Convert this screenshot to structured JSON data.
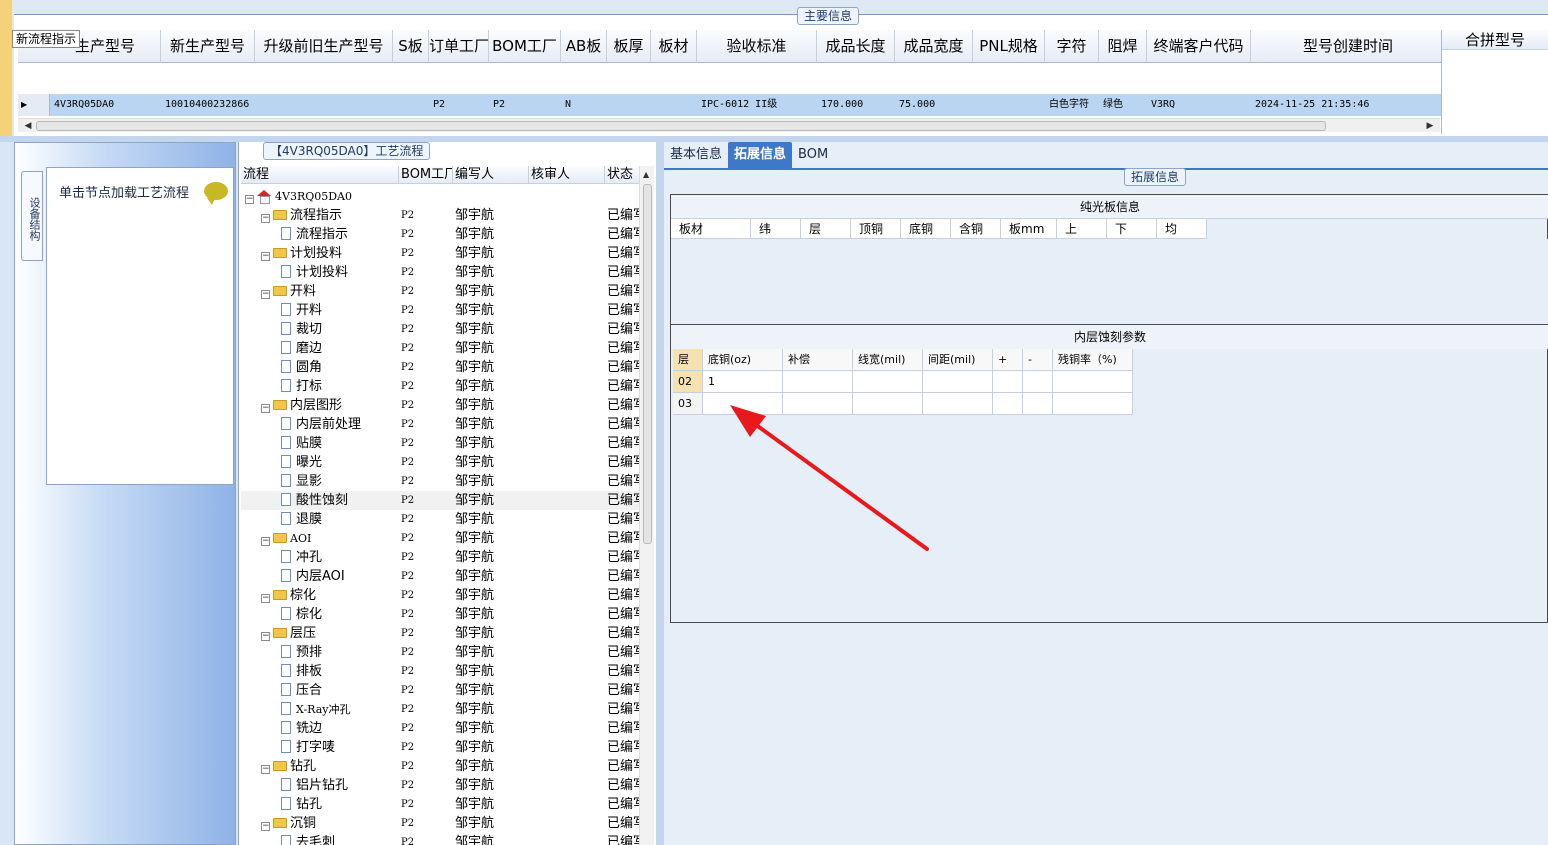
{
  "tooltip": {
    "text": "新流程指示"
  },
  "main_info": {
    "legend": "主要信息",
    "columns": [
      "生产型号",
      "新生产型号",
      "升级前旧生产型号",
      "S板",
      "订单工厂",
      "BOM工厂",
      "AB板",
      "板厚",
      "板材",
      "验收标准",
      "成品长度",
      "成品宽度",
      "PNL规格",
      "字符",
      "阻焊",
      "终端客户代码",
      "型号创建时间"
    ],
    "row": [
      "4V3RQ05DA0",
      "10010400232866",
      "",
      "",
      "P2",
      "P2",
      "N",
      "",
      "",
      "IPC-6012 II级",
      "170.000",
      "75.000",
      "",
      "白色字符",
      "绿色",
      "V3RQ",
      "2024-11-25 21:35:46"
    ],
    "merge_header": "合拼型号"
  },
  "left_panel": {
    "vertical_tab": "设备结构",
    "item": "单击节点加载工艺流程"
  },
  "tree": {
    "legend": "【4V3RQ05DA0】工艺流程",
    "columns": [
      "流程",
      "BOM工厂",
      "编写人",
      "核审人",
      "状态"
    ],
    "rows": [
      {
        "level": 0,
        "type": "root",
        "label": "4V3RQ05DA0",
        "bom": "",
        "writer": "",
        "status": ""
      },
      {
        "level": 1,
        "type": "folder",
        "label": "流程指示",
        "bom": "P2",
        "writer": "邹宇航",
        "status": "已编写"
      },
      {
        "level": 2,
        "type": "doc",
        "label": "流程指示",
        "bom": "P2",
        "writer": "邹宇航",
        "status": "已编写"
      },
      {
        "level": 1,
        "type": "folder",
        "label": "计划投料",
        "bom": "P2",
        "writer": "邹宇航",
        "status": "已编写"
      },
      {
        "level": 2,
        "type": "doc",
        "label": "计划投料",
        "bom": "P2",
        "writer": "邹宇航",
        "status": "已编写"
      },
      {
        "level": 1,
        "type": "folder",
        "label": "开料",
        "bom": "P2",
        "writer": "邹宇航",
        "status": "已编写"
      },
      {
        "level": 2,
        "type": "doc",
        "label": "开料",
        "bom": "P2",
        "writer": "邹宇航",
        "status": "已编写"
      },
      {
        "level": 2,
        "type": "doc",
        "label": "裁切",
        "bom": "P2",
        "writer": "邹宇航",
        "status": "已编写"
      },
      {
        "level": 2,
        "type": "doc",
        "label": "磨边",
        "bom": "P2",
        "writer": "邹宇航",
        "status": "已编写"
      },
      {
        "level": 2,
        "type": "doc",
        "label": "圆角",
        "bom": "P2",
        "writer": "邹宇航",
        "status": "已编写"
      },
      {
        "level": 2,
        "type": "doc",
        "label": "打标",
        "bom": "P2",
        "writer": "邹宇航",
        "status": "已编写"
      },
      {
        "level": 1,
        "type": "folder",
        "label": "内层图形",
        "bom": "P2",
        "writer": "邹宇航",
        "status": "已编写"
      },
      {
        "level": 2,
        "type": "doc",
        "label": "内层前处理",
        "bom": "P2",
        "writer": "邹宇航",
        "status": "已编写"
      },
      {
        "level": 2,
        "type": "doc",
        "label": "贴膜",
        "bom": "P2",
        "writer": "邹宇航",
        "status": "已编写"
      },
      {
        "level": 2,
        "type": "doc",
        "label": "曝光",
        "bom": "P2",
        "writer": "邹宇航",
        "status": "已编写"
      },
      {
        "level": 2,
        "type": "doc",
        "label": "显影",
        "bom": "P2",
        "writer": "邹宇航",
        "status": "已编写"
      },
      {
        "level": 2,
        "type": "doc",
        "label": "酸性蚀刻",
        "bom": "P2",
        "writer": "邹宇航",
        "status": "已编写",
        "selected": true
      },
      {
        "level": 2,
        "type": "doc",
        "label": "退膜",
        "bom": "P2",
        "writer": "邹宇航",
        "status": "已编写"
      },
      {
        "level": 1,
        "type": "folder",
        "label": "AOI",
        "bom": "P2",
        "writer": "邹宇航",
        "status": "已编写"
      },
      {
        "level": 2,
        "type": "doc",
        "label": "冲孔",
        "bom": "P2",
        "writer": "邹宇航",
        "status": "已编写"
      },
      {
        "level": 2,
        "type": "doc",
        "label": "内层AOI",
        "bom": "P2",
        "writer": "邹宇航",
        "status": "已编写"
      },
      {
        "level": 1,
        "type": "folder",
        "label": "棕化",
        "bom": "P2",
        "writer": "邹宇航",
        "status": "已编写"
      },
      {
        "level": 2,
        "type": "doc",
        "label": "棕化",
        "bom": "P2",
        "writer": "邹宇航",
        "status": "已编写"
      },
      {
        "level": 1,
        "type": "folder",
        "label": "层压",
        "bom": "P2",
        "writer": "邹宇航",
        "status": "已编写"
      },
      {
        "level": 2,
        "type": "doc",
        "label": "预排",
        "bom": "P2",
        "writer": "邹宇航",
        "status": "已编写"
      },
      {
        "level": 2,
        "type": "doc",
        "label": "排板",
        "bom": "P2",
        "writer": "邹宇航",
        "status": "已编写"
      },
      {
        "level": 2,
        "type": "doc",
        "label": "压合",
        "bom": "P2",
        "writer": "邹宇航",
        "status": "已编写"
      },
      {
        "level": 2,
        "type": "doc",
        "label": "X-Ray冲孔",
        "bom": "P2",
        "writer": "邹宇航",
        "status": "已编写"
      },
      {
        "level": 2,
        "type": "doc",
        "label": "铣边",
        "bom": "P2",
        "writer": "邹宇航",
        "status": "已编写"
      },
      {
        "level": 2,
        "type": "doc",
        "label": "打字唛",
        "bom": "P2",
        "writer": "邹宇航",
        "status": "已编写"
      },
      {
        "level": 1,
        "type": "folder",
        "label": "钻孔",
        "bom": "P2",
        "writer": "邹宇航",
        "status": "已编写"
      },
      {
        "level": 2,
        "type": "doc",
        "label": "铝片钻孔",
        "bom": "P2",
        "writer": "邹宇航",
        "status": "已编写"
      },
      {
        "level": 2,
        "type": "doc",
        "label": "钻孔",
        "bom": "P2",
        "writer": "邹宇航",
        "status": "已编写"
      },
      {
        "level": 1,
        "type": "folder",
        "label": "沉铜",
        "bom": "P2",
        "writer": "邹宇航",
        "status": "已编写"
      },
      {
        "level": 2,
        "type": "doc",
        "label": "去毛刺",
        "bom": "P2",
        "writer": "邹宇航",
        "status": "已编写"
      }
    ]
  },
  "right_panel": {
    "tabs": [
      "基本信息",
      "拓展信息",
      "BOM"
    ],
    "active_tab": "拓展信息",
    "legend": "拓展信息",
    "gloss": {
      "title": "纯光板信息",
      "columns": [
        "板材",
        "纬",
        "层",
        "顶铜",
        "底铜",
        "含铜",
        "板mm",
        "上",
        "下",
        "均"
      ]
    },
    "etch": {
      "title": "内层蚀刻参数",
      "columns": [
        "层",
        "底铜(oz)",
        "补偿",
        "线宽(mil)",
        "间距(mil)",
        "+",
        "-",
        "残铜率（%)"
      ],
      "rows": [
        [
          "02",
          "1",
          "",
          "",
          "",
          "",
          "",
          ""
        ],
        [
          "03",
          "",
          "",
          "",
          "",
          "",
          "",
          ""
        ]
      ]
    }
  },
  "colors": {
    "accent": "#3d78c9",
    "selection": "#b9d5f2",
    "annotation_arrow": "#e8191c"
  }
}
